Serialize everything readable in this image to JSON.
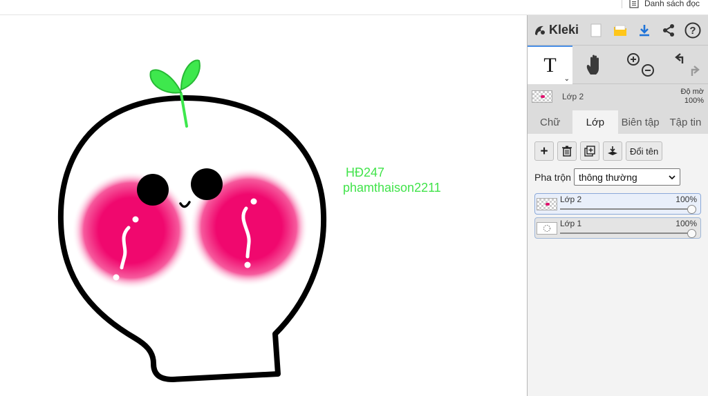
{
  "browser": {
    "reading_list_label": "Danh sách đọc"
  },
  "canvas": {
    "text_line1": "HĐ247",
    "text_line2": "phamthaison2211",
    "text_color": "#41e34a",
    "cheek_color": "#f0086e",
    "sprout_color": "#3ee84d"
  },
  "app": {
    "name": "Kleki",
    "accent": "#1e73d8",
    "top_buttons": [
      "new-image-icon",
      "open-folder-icon",
      "download-icon",
      "share-icon",
      "help-icon"
    ],
    "tools": [
      "text-tool-icon",
      "hand-tool-icon",
      "zoom-icon",
      "undo-redo-icon"
    ],
    "text_tool_glyph": "T",
    "dropdown_glyph": "⌄"
  },
  "current_layer": {
    "name": "Lớp 2",
    "opacity_label": "Độ mờ",
    "opacity_value": "100%"
  },
  "tabs": [
    {
      "label": "Chữ",
      "active": false
    },
    {
      "label": "Lớp",
      "active": true
    },
    {
      "label": "Biên tập",
      "active": false
    },
    {
      "label": "Tập tin",
      "active": false
    }
  ],
  "layer_actions": {
    "add": "+",
    "rename_label": "Đổi tên"
  },
  "blend": {
    "label": "Pha trộn",
    "value": "thông thường"
  },
  "layers": [
    {
      "name": "Lớp 2",
      "opacity": "100%",
      "selected": true
    },
    {
      "name": "Lớp 1",
      "opacity": "100%",
      "selected": false
    }
  ]
}
